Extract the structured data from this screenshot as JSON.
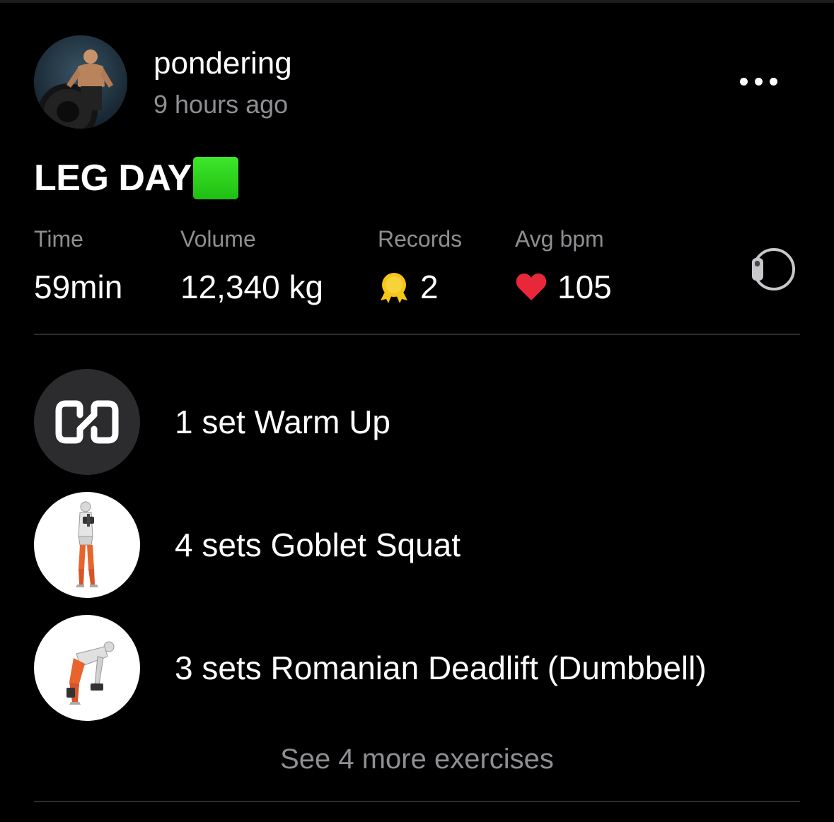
{
  "post": {
    "username": "pondering",
    "timestamp": "9 hours ago",
    "title": "LEG DAY",
    "title_emoji_color": "#2ecc1f"
  },
  "icons": {
    "more": "more-horizontal-icon",
    "records": "medal-icon",
    "bpm": "heart-icon",
    "watch": "smartwatch-icon"
  },
  "stats": {
    "time": {
      "label": "Time",
      "value": "59min"
    },
    "volume": {
      "label": "Volume",
      "value": "12,340 kg"
    },
    "records": {
      "label": "Records",
      "value": "2"
    },
    "bpm": {
      "label": "Avg bpm",
      "value": "105"
    }
  },
  "exercises": [
    {
      "label": "1 set Warm Up",
      "icon": "dumbbell-icon"
    },
    {
      "label": "4 sets Goblet Squat",
      "icon": "goblet-squat-figure"
    },
    {
      "label": "3 sets Romanian Deadlift (Dumbbell)",
      "icon": "romanian-deadlift-figure"
    }
  ],
  "see_more": "See 4 more exercises",
  "colors": {
    "background": "#000000",
    "muted_text": "#8e8e93",
    "heart": "#e8283a",
    "medal": "#f5c518",
    "divider": "#2c2c2e"
  }
}
